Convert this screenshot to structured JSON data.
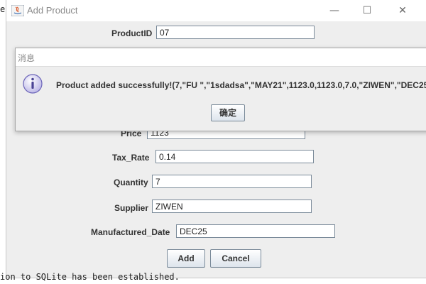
{
  "console": {
    "left_fragment": "e",
    "bottom_line": "ion to SQLite has been established."
  },
  "window": {
    "title": "Add Product",
    "controls": {
      "minimize": "—",
      "maximize": "☐",
      "close": "✕"
    }
  },
  "form": {
    "product_id": {
      "label": "ProductID",
      "value": "07"
    },
    "price": {
      "label": "Price",
      "value": "1123"
    },
    "tax_rate": {
      "label": "Tax_Rate",
      "value": "0.14"
    },
    "quantity": {
      "label": "Quantity",
      "value": "7"
    },
    "supplier": {
      "label": "Supplier",
      "value": "ZIWEN"
    },
    "manufactured_date": {
      "label": "Manufactured_Date",
      "value": "DEC25"
    }
  },
  "buttons": {
    "add": "Add",
    "cancel": "Cancel"
  },
  "dialog": {
    "title": "消息",
    "message": "Product added successfully!(7,\"FU \",\"1sdadsa\",\"MAY21\",1123.0,1123.0,7.0,\"ZIWEN\",\"DEC25",
    "ok": "确定",
    "icon": "info-icon"
  }
}
